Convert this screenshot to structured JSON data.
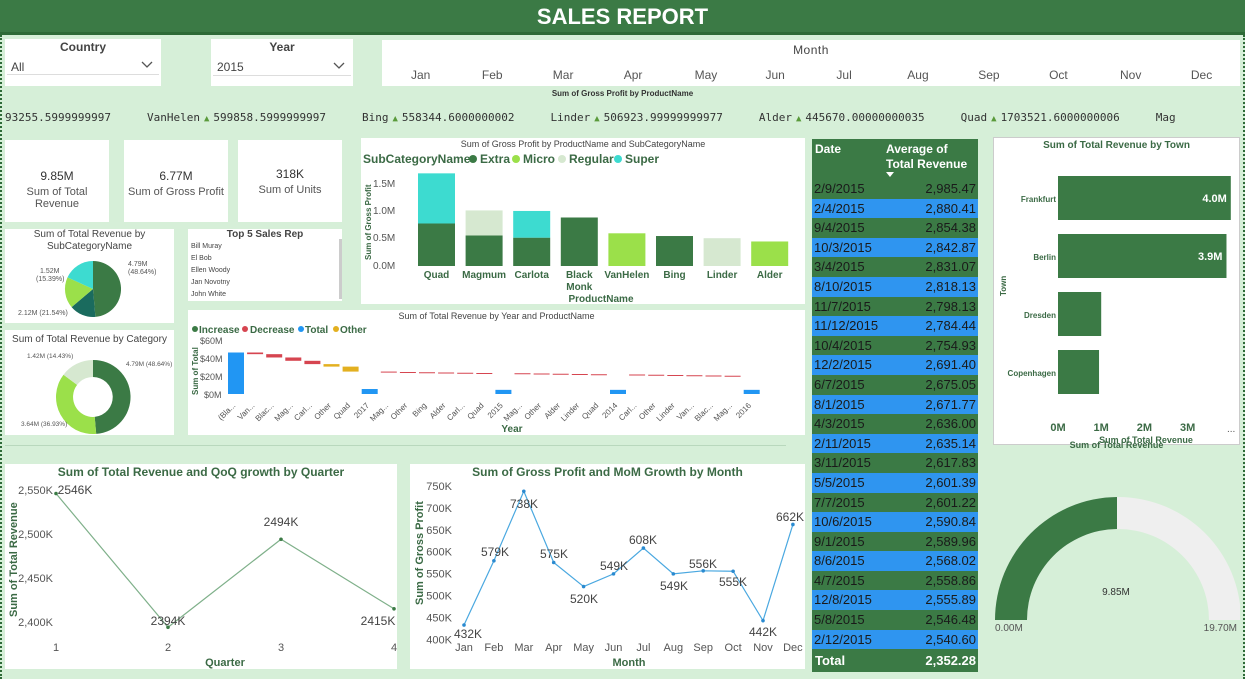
{
  "title": "SALES REPORT",
  "slicers": {
    "country": {
      "title": "Country",
      "value": "All"
    },
    "year": {
      "title": "Year",
      "value": "2015"
    },
    "month": {
      "title": "Month",
      "items": [
        "Jan",
        "Feb",
        "Mar",
        "Apr",
        "May",
        "Jun",
        "Jul",
        "Aug",
        "Sep",
        "Oct",
        "Nov",
        "Dec"
      ]
    }
  },
  "ticker": {
    "label": "Sum of Gross Profit by ProductName",
    "items": [
      {
        "name": "",
        "value": "93255.5999999997"
      },
      {
        "name": "VanHelen",
        "value": "599858.5999999997"
      },
      {
        "name": "Bing",
        "value": "558344.6000000002"
      },
      {
        "name": "Linder",
        "value": "506923.99999999977"
      },
      {
        "name": "Alder",
        "value": "445670.00000000035"
      },
      {
        "name": "Quad",
        "value": "1703521.6000000006"
      },
      {
        "name": "Mag",
        "value": ""
      }
    ]
  },
  "kpis": [
    {
      "value": "9.85M",
      "label": "Sum of Total Revenue"
    },
    {
      "value": "6.77M",
      "label": "Sum of Gross Profit"
    },
    {
      "value": "318K",
      "label": "Sum of Units"
    }
  ],
  "pie_subcat": {
    "title": "Sum of Total Revenue by SubCategoryName",
    "labels": [
      "4.79M (48.64%)",
      "1.52M (15.39%)",
      "2.12M (21.54%)"
    ],
    "colors": {
      "extra": "#3b7a45",
      "regular": "#1a6b5e",
      "super": "#3ddbd0",
      "micro": "#9be04a"
    }
  },
  "top5": {
    "title": "Top 5 Sales Rep",
    "reps": [
      "Bill Muray",
      "El Bob",
      "Ellen Woody",
      "Jan Novotny",
      "John White"
    ]
  },
  "donut_cat": {
    "title": "Sum of Total Revenue by Category",
    "labels": [
      "1.42M (14.43%)",
      "4.79M (48.64%)",
      "3.64M (36.93%)"
    ]
  },
  "stacked": {
    "title": "Sum of Gross Profit by ProductName and SubCategoryName",
    "legend_title": "SubCategoryName",
    "legend": [
      "Extra",
      "Micro",
      "Regular",
      "Super"
    ],
    "xlabel": "ProductName",
    "ylabel": "Sum of Gross Profit",
    "yticks": [
      "1.5M",
      "1.0M",
      "0.5M",
      "0.0M"
    ]
  },
  "waterfall": {
    "title": "Sum of Total Revenue by Year and ProductName",
    "legend": [
      "Increase",
      "Decrease",
      "Total",
      "Other"
    ],
    "ylabel": "Sum of Total",
    "xlabel": "Year",
    "yticks": [
      "$60M",
      "$40M",
      "$20M",
      "$0M"
    ],
    "xlabels": [
      "(Bla...",
      "Van...",
      "Blac...",
      "Mag...",
      "Carl...",
      "Other",
      "Quad",
      "2017",
      "Mag...",
      "Other",
      "Bing",
      "Alder",
      "Carl...",
      "Quad",
      "2015",
      "Mag...",
      "Other",
      "Alder",
      "Linder",
      "Quad",
      "2014",
      "Carl...",
      "Other",
      "Linder",
      "Van...",
      "Blac...",
      "Mag...",
      "2016"
    ]
  },
  "table": {
    "headers": [
      "Date",
      "Average of Total Revenue"
    ],
    "rows": [
      [
        "2/9/2015",
        "2,985.47"
      ],
      [
        "2/4/2015",
        "2,880.41"
      ],
      [
        "9/4/2015",
        "2,854.38"
      ],
      [
        "10/3/2015",
        "2,842.87"
      ],
      [
        "3/4/2015",
        "2,831.07"
      ],
      [
        "8/10/2015",
        "2,818.13"
      ],
      [
        "11/7/2015",
        "2,798.13"
      ],
      [
        "11/12/2015",
        "2,784.44"
      ],
      [
        "10/4/2015",
        "2,754.93"
      ],
      [
        "12/2/2015",
        "2,691.40"
      ],
      [
        "6/7/2015",
        "2,675.05"
      ],
      [
        "8/1/2015",
        "2,671.77"
      ],
      [
        "4/3/2015",
        "2,636.00"
      ],
      [
        "2/11/2015",
        "2,635.14"
      ],
      [
        "3/11/2015",
        "2,617.83"
      ],
      [
        "5/5/2015",
        "2,601.39"
      ],
      [
        "7/7/2015",
        "2,601.22"
      ],
      [
        "10/6/2015",
        "2,590.84"
      ],
      [
        "9/1/2015",
        "2,589.96"
      ],
      [
        "8/6/2015",
        "2,568.02"
      ],
      [
        "4/7/2015",
        "2,558.86"
      ],
      [
        "12/8/2015",
        "2,555.89"
      ],
      [
        "5/8/2015",
        "2,546.48"
      ],
      [
        "2/12/2015",
        "2,540.60"
      ]
    ],
    "total_label": "Total",
    "total_value": "2,352.28"
  },
  "town_bar": {
    "title": "Sum of Total Revenue by Town",
    "ylabel": "Town",
    "xlabel": "Sum of Total Revenue",
    "xticks": [
      "0M",
      "1M",
      "2M",
      "3M"
    ],
    "towns": [
      "Frankfurt",
      "Berlin",
      "Dresden",
      "Copenhagen"
    ],
    "labels": [
      "4.0M",
      "3.9M",
      "",
      ""
    ]
  },
  "gauge": {
    "title": "Sum of Total Revenue",
    "value": "9.85M",
    "min": "0.00M",
    "max": "19.70M"
  },
  "chart_data": [
    {
      "type": "pie",
      "title": "Sum of Total Revenue by SubCategoryName",
      "categories": [
        "Extra",
        "Regular",
        "Micro",
        "Super"
      ],
      "values": [
        4.79,
        1.52,
        2.12,
        1.42
      ]
    },
    {
      "type": "pie",
      "title": "Sum of Total Revenue by Category",
      "values": [
        4.79,
        3.64,
        1.42
      ]
    },
    {
      "type": "bar",
      "title": "Sum of Gross Profit by ProductName and SubCategoryName",
      "categories": [
        "Quad",
        "Magmum",
        "Carlota",
        "Black Monk",
        "VanHelen",
        "Bing",
        "Linder",
        "Alder"
      ],
      "series": [
        {
          "name": "Extra",
          "values": [
            0.78,
            0.56,
            0.52,
            0.89,
            0,
            0.55,
            0,
            0
          ]
        },
        {
          "name": "Micro",
          "values": [
            0,
            0,
            0,
            0,
            0.6,
            0,
            0,
            0.45
          ]
        },
        {
          "name": "Regular",
          "values": [
            0,
            0.46,
            0,
            0,
            0,
            0,
            0.51,
            0
          ]
        },
        {
          "name": "Super",
          "values": [
            0.92,
            0,
            0.49,
            0,
            0,
            0,
            0,
            0
          ]
        }
      ],
      "ylim": [
        0,
        1.8
      ]
    },
    {
      "type": "bar",
      "title": "Sum of Total Revenue by Town",
      "categories": [
        "Frankfurt",
        "Berlin",
        "Dresden",
        "Copenhagen"
      ],
      "values": [
        4.0,
        3.9,
        1.0,
        0.95
      ],
      "xlim": [
        0,
        4.2
      ]
    },
    {
      "type": "line",
      "title": "Sum of Total Revenue and QoQ growth by Quarter",
      "xlabel": "Quarter",
      "ylabel": "Sum of Total Revenue",
      "x": [
        1,
        2,
        3,
        4
      ],
      "values": [
        2546,
        2394,
        2494,
        2415
      ],
      "labels": [
        "2546K",
        "2394K",
        "2494K",
        "2415K"
      ],
      "yticks": [
        "2,550K",
        "2,500K",
        "2,450K",
        "2,400K"
      ],
      "ylim": [
        2390,
        2555
      ]
    },
    {
      "type": "line",
      "title": "Sum of Gross Profit and MoM Growth by Month",
      "xlabel": "Month",
      "ylabel": "Sum of Gross Profit",
      "categories": [
        "Jan",
        "Feb",
        "Mar",
        "Apr",
        "May",
        "Jun",
        "Jul",
        "Aug",
        "Sep",
        "Oct",
        "Nov",
        "Dec"
      ],
      "values": [
        432,
        579,
        738,
        575,
        520,
        549,
        608,
        549,
        556,
        555,
        442,
        662
      ],
      "labels": [
        "432K",
        "579K",
        "738K",
        "575K",
        "520K",
        "549K",
        "608K",
        "549K",
        "556K",
        "555K",
        "442K",
        "662K"
      ],
      "yticks": [
        "750K",
        "700K",
        "650K",
        "600K",
        "550K",
        "500K",
        "450K",
        "400K"
      ],
      "ylim": [
        400,
        750
      ]
    },
    {
      "type": "bar",
      "title": "Sum of Total Revenue by Year and ProductName",
      "categories": [
        "(Bla...",
        "Van...",
        "Blac...",
        "Mag...",
        "Carl...",
        "Other",
        "Quad",
        "2017",
        "Mag...",
        "Other",
        "Bing",
        "Alder",
        "Carl...",
        "Quad",
        "2015",
        "Mag...",
        "Other",
        "Alder",
        "Linder",
        "Quad",
        "2014",
        "Carl...",
        "Other",
        "Linder",
        "Van...",
        "Blac...",
        "Mag...",
        "2016"
      ],
      "values": [
        50,
        -2,
        -4,
        -4,
        -4,
        -3,
        -6,
        6,
        -0.5,
        -0.3,
        -0.3,
        -0.3,
        -0.3,
        -0.3,
        5,
        -0.3,
        -0.3,
        -0.3,
        -0.3,
        -0.3,
        5,
        -0.3,
        -0.3,
        -0.3,
        -0.3,
        -0.3,
        -0.3,
        5
      ],
      "ylim": [
        0,
        60
      ]
    },
    {
      "type": "gauge",
      "title": "Sum of Total Revenue",
      "value": 9.85,
      "min": 0,
      "max": 19.7
    }
  ]
}
